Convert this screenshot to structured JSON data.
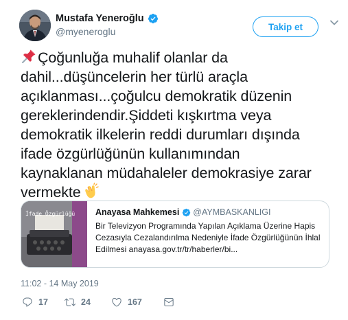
{
  "author": {
    "name": "Mustafa Yeneroğlu",
    "handle": "@myeneroglu",
    "verified": true
  },
  "follow_button": {
    "label": "Takip et"
  },
  "tweet": {
    "lines": [
      "Çoğunluğa muhalif olanlar da",
      "dahil...düşüncelerin her türlü araçla",
      "açıklanması...çoğulcu demokratik düzenin",
      "gereklerindendir.Şiddeti kışkırtma veya",
      "demokratik ilkelerin reddi durumları dışında",
      "ifade özgürlüğünün kullanımından",
      "kaynaklanan müdahaleler demokrasiye zarar",
      "vermekte"
    ],
    "leading_emoji": "pushpin-icon",
    "trailing_emoji": "clapping-hands-icon"
  },
  "quoted_card": {
    "name": "Anayasa Mahkemesi",
    "handle": "@AYMBASKANLIGI",
    "verified": true,
    "text_lines": [
      "Bir Televizyon Programında Yapılan Açıklama Üzerine Hapis",
      "Cezasıyla Cezalandırılma Nedeniyle İfade Özgürlüğünün İhlal",
      "Edilmesi anayasa.gov.tr/tr/haberler/bi..."
    ],
    "thumbnail_text": "İfade Özgürlüğü"
  },
  "timestamp": "11:02 - 14 May 2019",
  "actions": {
    "reply_count": "17",
    "retweet_count": "24",
    "like_count": "167"
  },
  "colors": {
    "accent": "#1da1f2",
    "text": "#14171a",
    "muted": "#657786",
    "border": "#cfd9de"
  }
}
